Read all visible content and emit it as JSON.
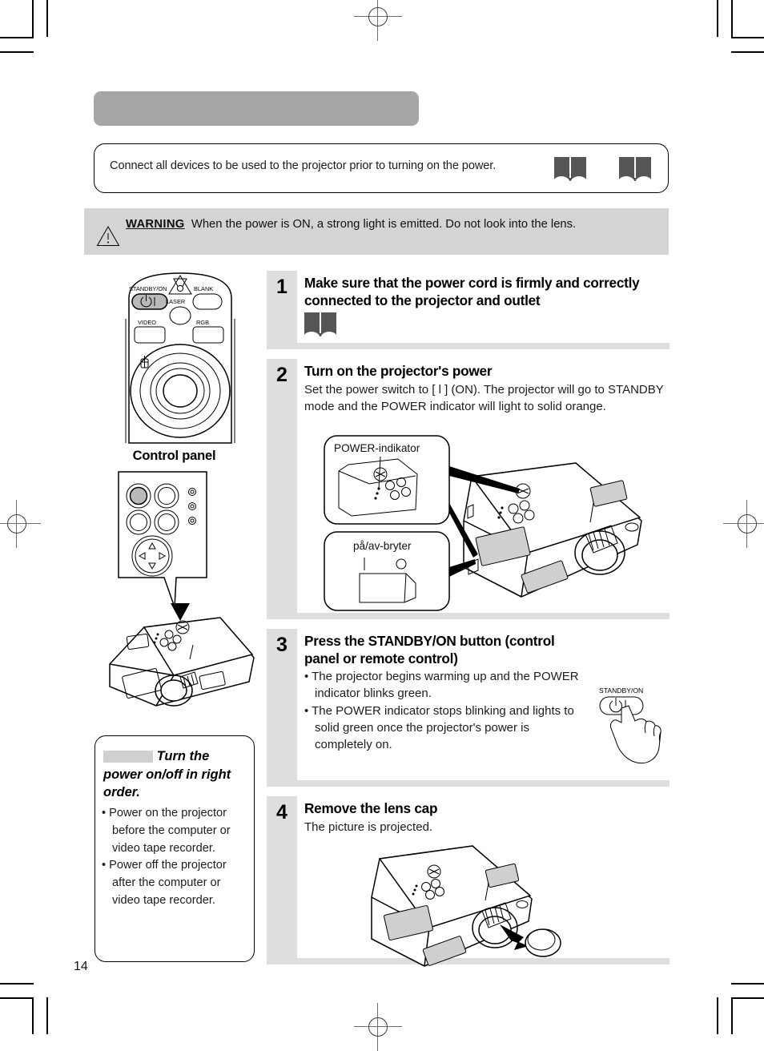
{
  "document": {
    "page_number": "14",
    "title_bar_text": ""
  },
  "intro": {
    "text": "Connect all devices to be used to the projector prior to turning on the power.",
    "icons": [
      "book-icon",
      "book-icon"
    ]
  },
  "warning": {
    "icon": "warning-triangle-icon",
    "label": "WARNING",
    "text": "When the power is ON, a strong light is emitted. Do not look into the lens."
  },
  "left_column": {
    "remote": {
      "caption": "Control panel",
      "buttons": {
        "standby_on": "STANDBY/ON",
        "laser": "LASER",
        "blank": "BLANK",
        "video": "VIDEO",
        "rgb": "RGB"
      }
    },
    "note": {
      "heading_redacted": "",
      "heading": "Turn the power on/off in right order.",
      "bullets": [
        "• Power on the projector before the computer or video tape recorder.",
        "• Power off the projector after the computer or video tape recorder."
      ]
    }
  },
  "steps": [
    {
      "number": "1",
      "title": "Make sure that the power cord is firmly and correctly connected to the projector and outlet",
      "text": "",
      "icon": "book-icon"
    },
    {
      "number": "2",
      "title": "Turn on the projector's power",
      "text": "Set the power switch to [ l ] (ON). The projector will go to STANDBY mode and the POWER indicator will light to solid orange.",
      "callouts": {
        "power_indicator": "POWER-indikator",
        "power_switch": "på/av-bryter"
      }
    },
    {
      "number": "3",
      "title": "Press the STANDBY/ON button (control panel or remote control)",
      "bullets": [
        "• The projector begins warming up and the POWER indicator blinks green.",
        "• The POWER indicator stops blinking and lights to solid green once the projector's power is completely on."
      ],
      "button_label": "STANDBY/ON"
    },
    {
      "number": "4",
      "title": "Remove the lens cap",
      "text": "The picture is projected."
    }
  ],
  "colors": {
    "title_bar": "#a6a6a6",
    "warning_band": "#d4d4d4",
    "step_grey": "#dedede",
    "book_icon": "#555555",
    "redact_grey": "#d0d0d0"
  }
}
